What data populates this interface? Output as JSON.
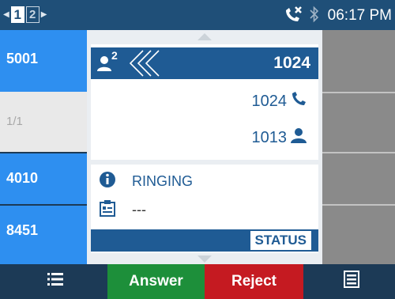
{
  "statusbar": {
    "page_active": "1",
    "page_inactive": "2",
    "time": "06:17 PM"
  },
  "left_keys": [
    "5001",
    "1/1",
    "4010",
    "8451"
  ],
  "popup": {
    "conference_count": "2",
    "header_number": "1024",
    "line_number": "1024",
    "contact_number": "1013",
    "status_text": "RINGING",
    "detail_text": "---",
    "status_button": "STATUS"
  },
  "softkeys": {
    "answer": "Answer",
    "reject": "Reject"
  },
  "colors": {
    "accent": "#2e8ff0",
    "header": "#1f5b94",
    "answer": "#1d8f3a",
    "reject": "#c51a21"
  },
  "icons": [
    "missed-call-icon",
    "bluetooth-icon",
    "conference-icon",
    "phone-icon",
    "person-icon",
    "info-icon",
    "contact-card-icon",
    "list-icon",
    "menu-icon"
  ]
}
